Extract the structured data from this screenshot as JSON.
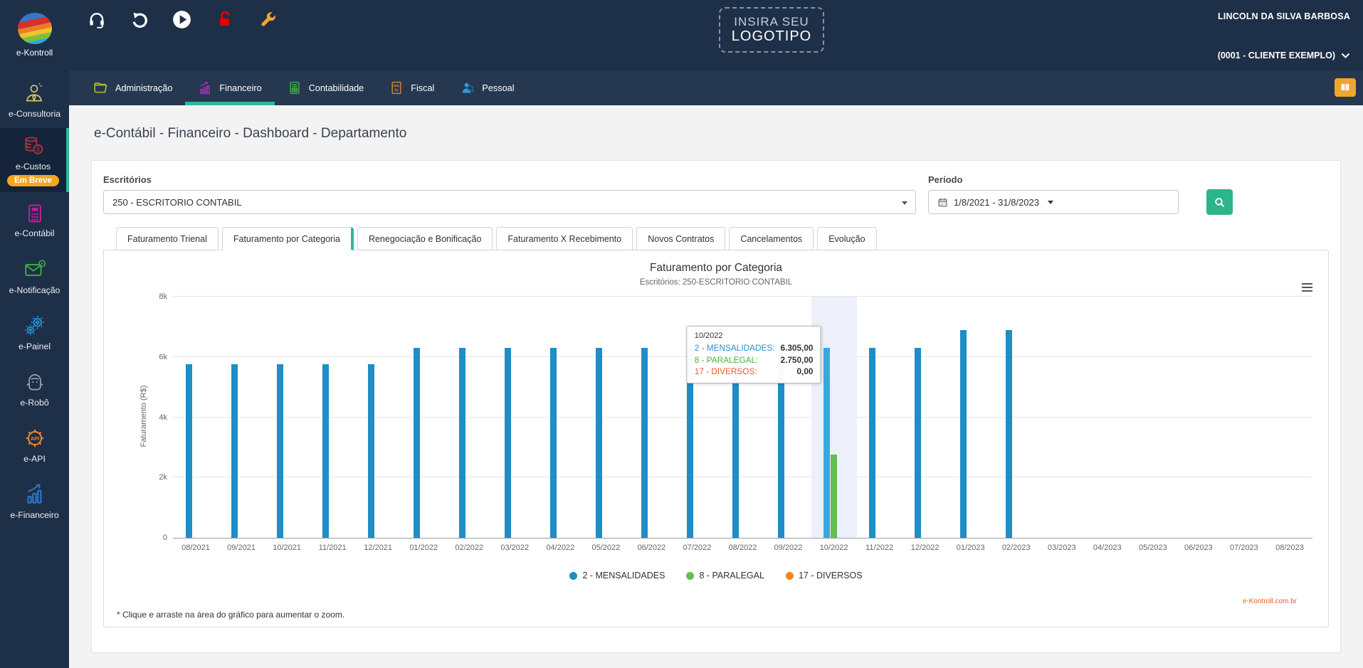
{
  "topbar": {
    "logo_line1": "INSIRA SEU",
    "logo_line2": "LOGOTIPO",
    "user_name": "LINCOLN DA SILVA BARBOSA",
    "client_selector": "(0001 - CLIENTE EXEMPLO)"
  },
  "icons": {
    "topbar": [
      "headset",
      "undo",
      "play",
      "unlock",
      "wrench"
    ],
    "nav_right": "book",
    "period": "calendar",
    "search": "magnifier",
    "chart_menu": "hamburger"
  },
  "sidebar": {
    "logo_label": "e-Kontroll",
    "items": [
      {
        "label": "e-Consultoria",
        "icon": "consultant"
      },
      {
        "label": "e-Custos",
        "icon": "coins",
        "badge": "Em Breve",
        "active": true
      },
      {
        "label": "e-Contábil",
        "icon": "calculator"
      },
      {
        "label": "e-Notificação",
        "icon": "envelope-clock"
      },
      {
        "label": "e-Painel",
        "icon": "gears"
      },
      {
        "label": "e-Robô",
        "icon": "robot"
      },
      {
        "label": "e-API",
        "icon": "api-gear"
      },
      {
        "label": "e-Financeiro",
        "icon": "bar-chart-arrow"
      }
    ]
  },
  "navbar": {
    "items": [
      {
        "label": "Administração",
        "icon": "folder"
      },
      {
        "label": "Financeiro",
        "icon": "finance-chart",
        "active": true
      },
      {
        "label": "Contabilidade",
        "icon": "ledger-document"
      },
      {
        "label": "Fiscal",
        "icon": "xml-document"
      },
      {
        "label": "Pessoal",
        "icon": "person-search"
      }
    ]
  },
  "breadcrumb": "e-Contábil - Financeiro - Dashboard - Departamento",
  "filters": {
    "office_label": "Escritórios",
    "office_value": "250 - ESCRITORIO CONTABIL",
    "period_label": "Período",
    "period_value": "1/8/2021 - 31/8/2023"
  },
  "tabs": {
    "active_index": 1,
    "items": [
      {
        "label": "Faturamento Trienal"
      },
      {
        "label": "Faturamento por Categoria"
      },
      {
        "label": "Renegociação e Bonificação"
      },
      {
        "label": "Faturamento X Recebimento"
      },
      {
        "label": "Novos Contratos"
      },
      {
        "label": "Cancelamentos"
      },
      {
        "label": "Evolução"
      }
    ]
  },
  "chart_data": {
    "type": "bar",
    "title": "Faturamento por Categoria",
    "subtitle": "Escritórios: 250-ESCRITORIO CONTABIL",
    "ylabel": "Faturamento (R$)",
    "ylim": [
      0,
      8000
    ],
    "grid": true,
    "legend_position": "bottom",
    "yticks": [
      {
        "v": 0,
        "label": "0"
      },
      {
        "v": 2000,
        "label": "2k"
      },
      {
        "v": 4000,
        "label": "4k"
      },
      {
        "v": 6000,
        "label": "6k"
      },
      {
        "v": 8000,
        "label": "8k"
      }
    ],
    "categories": [
      "08/2021",
      "09/2021",
      "10/2021",
      "11/2021",
      "12/2021",
      "01/2022",
      "02/2022",
      "03/2022",
      "04/2022",
      "05/2022",
      "06/2022",
      "07/2022",
      "08/2022",
      "09/2022",
      "10/2022",
      "11/2022",
      "12/2022",
      "01/2023",
      "02/2023",
      "03/2023",
      "04/2023",
      "05/2023",
      "06/2023",
      "07/2023",
      "08/2023"
    ],
    "series": [
      {
        "name": "2 - MENSALIDADES",
        "color": "#1f8dc6",
        "hover_color": "#36a9e1",
        "values": [
          5750,
          5750,
          5750,
          5750,
          5750,
          6305,
          6305,
          6305,
          6305,
          6305,
          6305,
          6305,
          6305,
          6305,
          6305,
          6305,
          6305,
          6900,
          6900,
          0,
          0,
          0,
          0,
          0,
          0
        ]
      },
      {
        "name": "8 - PARALEGAL",
        "color": "#66bd4f",
        "values": [
          0,
          0,
          0,
          0,
          0,
          0,
          0,
          0,
          0,
          0,
          0,
          0,
          0,
          0,
          2750,
          0,
          0,
          0,
          0,
          0,
          0,
          0,
          0,
          0,
          0
        ]
      },
      {
        "name": "17 - DIVERSOS",
        "color": "#f58220",
        "values": [
          0,
          0,
          0,
          0,
          0,
          0,
          0,
          0,
          0,
          0,
          0,
          0,
          0,
          0,
          0,
          0,
          0,
          0,
          0,
          0,
          0,
          0,
          0,
          0,
          0
        ]
      }
    ],
    "hover": {
      "index": 14,
      "category": "10/2022",
      "rows": [
        {
          "label": "2 - MENSALIDADES:",
          "value": "6.305,00",
          "color": "#2f8dc6"
        },
        {
          "label": "8 - PARALEGAL:",
          "value": "2.750,00",
          "color": "#4cb140"
        },
        {
          "label": "17 - DIVERSOS:",
          "value": "0,00",
          "color": "#f1582c"
        }
      ]
    }
  },
  "footnote": "* Clique e arraste na área do gráfico para aumentar o zoom.",
  "credit": "e-Kontroll.com.br",
  "colors": {
    "accent_teal": "#2cba9c",
    "topbar_navy": "#1e2f48",
    "navbar_navy": "#263850",
    "badge_orange": "#f6a51d",
    "search_green": "#2cb58a",
    "hover_band": "#edf0fa"
  }
}
